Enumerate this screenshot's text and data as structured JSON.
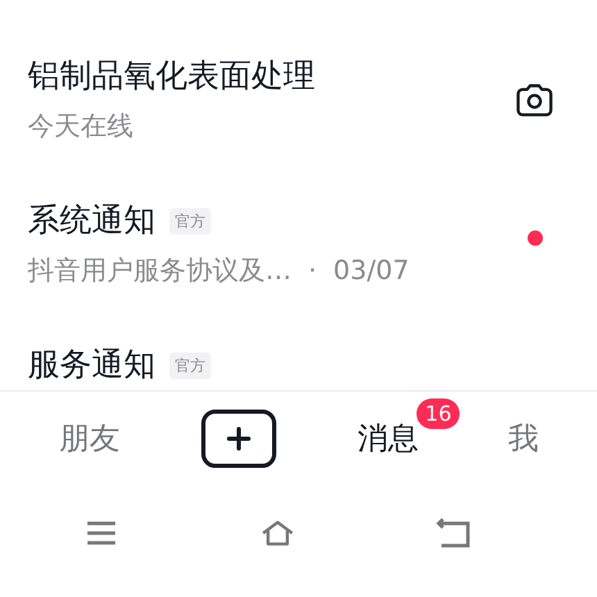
{
  "conversations": [
    {
      "kind": "camera",
      "title": "铝制品氧化表面处理",
      "subtitle": "今天在线"
    },
    {
      "kind": "official",
      "title": "系统通知",
      "tag": "官方",
      "subtitle": "抖音用户服务协议及…",
      "separator": "·",
      "time": "03/07",
      "unread": true
    },
    {
      "kind": "official",
      "title": "服务通知",
      "tag": "官方"
    }
  ],
  "tabs": [
    {
      "kind": "text",
      "label": "朋友",
      "selected": false
    },
    {
      "kind": "plus",
      "selected": false
    },
    {
      "kind": "text",
      "label": "消息",
      "selected": true,
      "badge": "16"
    },
    {
      "kind": "text",
      "label": "我",
      "selected": false
    }
  ]
}
